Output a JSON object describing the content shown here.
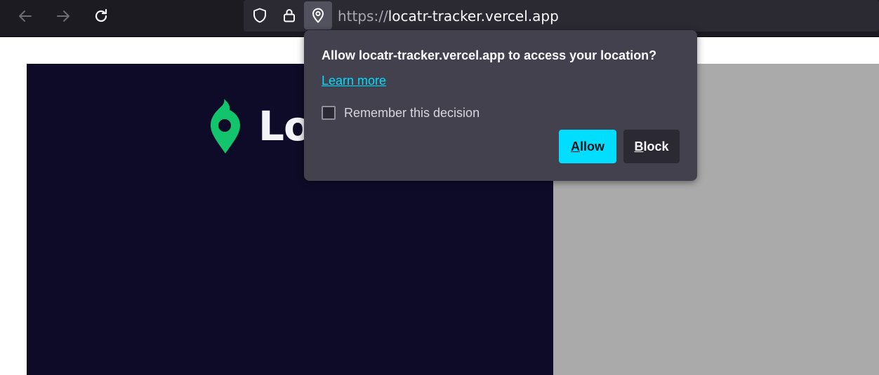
{
  "browser": {
    "back_icon": "arrow-left-icon",
    "forward_icon": "arrow-right-icon",
    "reload_icon": "reload-icon",
    "tracking_icon": "shield-icon",
    "lock_icon": "lock-icon",
    "permission_icon": "location-pin-icon",
    "url_scheme": "https://",
    "url_host": "locatr-tracker.vercel.app"
  },
  "page": {
    "logo_icon": "map-pin-logo-icon",
    "logo_text": "Lo",
    "brand_color": "#12c46b",
    "hero_background": "#0e0b28",
    "side_background": "#aaaaaa"
  },
  "popup": {
    "title": "Allow locatr-tracker.vercel.app to access your location?",
    "learn_more": "Learn more",
    "remember_label": "Remember this decision",
    "remember_checked": false,
    "allow_key": "A",
    "allow_rest": "llow",
    "block_key": "B",
    "block_rest": "lock",
    "accent_color": "#00ddff"
  }
}
